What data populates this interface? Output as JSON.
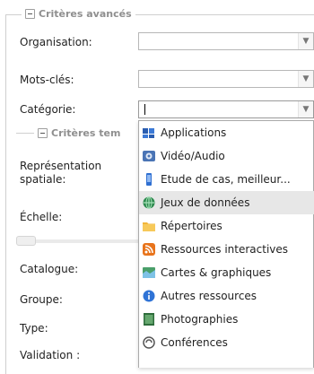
{
  "advanced": {
    "legend": "Critères avancés",
    "labels": {
      "organisation": "Organisation:",
      "keywords": "Mots-clés:",
      "category": "Catégorie:"
    },
    "category_value": ""
  },
  "temporal": {
    "legend": "Critères tem"
  },
  "lower_labels": {
    "spatial": "Représentation spatiale:",
    "scale": "Échelle:",
    "catalogue": "Catalogue:",
    "group": "Groupe:",
    "type": "Type:",
    "validation": "Validation :"
  },
  "category_dropdown": {
    "selected_index": 3,
    "items": [
      {
        "label": "Applications",
        "icon": "applications-icon"
      },
      {
        "label": "Vidéo/Audio",
        "icon": "video-audio-icon"
      },
      {
        "label": "Etude de cas, meilleur...",
        "icon": "case-study-icon"
      },
      {
        "label": "Jeux de données",
        "icon": "datasets-icon"
      },
      {
        "label": "Répertoires",
        "icon": "folder-icon"
      },
      {
        "label": "Ressources interactives",
        "icon": "rss-icon"
      },
      {
        "label": "Cartes & graphiques",
        "icon": "maps-charts-icon"
      },
      {
        "label": "Autres ressources",
        "icon": "info-icon"
      },
      {
        "label": "Photographies",
        "icon": "photo-icon"
      },
      {
        "label": "Conférences",
        "icon": "conference-icon"
      }
    ]
  },
  "colors": {
    "legend_text": "#8f8f8f",
    "selected_item": "#e7e7e7",
    "border": "#b7b7b7"
  }
}
